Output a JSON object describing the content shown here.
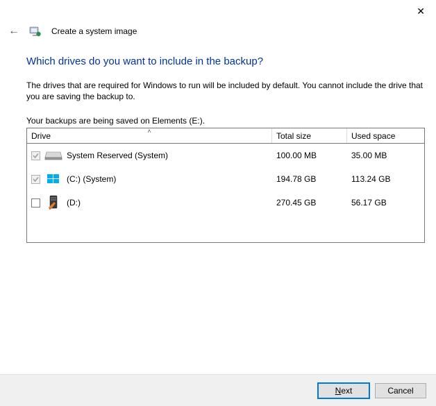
{
  "window": {
    "close_glyph": "✕"
  },
  "header": {
    "back_arrow": "←",
    "title": "Create a system image"
  },
  "page": {
    "heading": "Which drives do you want to include in the backup?",
    "intro": "The drives that are required for Windows to run will be included by default. You cannot include the drive that you are saving the backup to.",
    "saved_on": "Your backups are being saved on Elements (E:)."
  },
  "table": {
    "col_drive": "Drive",
    "col_total": "Total size",
    "col_used": "Used space",
    "rows": [
      {
        "label": "System Reserved (System)",
        "total": "100.00 MB",
        "used": "35.00 MB",
        "checked": true,
        "locked": true,
        "icon": "hdd"
      },
      {
        "label": "(C:) (System)",
        "total": "194.78 GB",
        "used": "113.24 GB",
        "checked": true,
        "locked": true,
        "icon": "winflag"
      },
      {
        "label": "(D:)",
        "total": "270.45 GB",
        "used": "56.17 GB",
        "checked": false,
        "locked": false,
        "icon": "tower"
      }
    ]
  },
  "footer": {
    "next_mnemonic": "N",
    "next_rest": "ext",
    "cancel": "Cancel"
  }
}
